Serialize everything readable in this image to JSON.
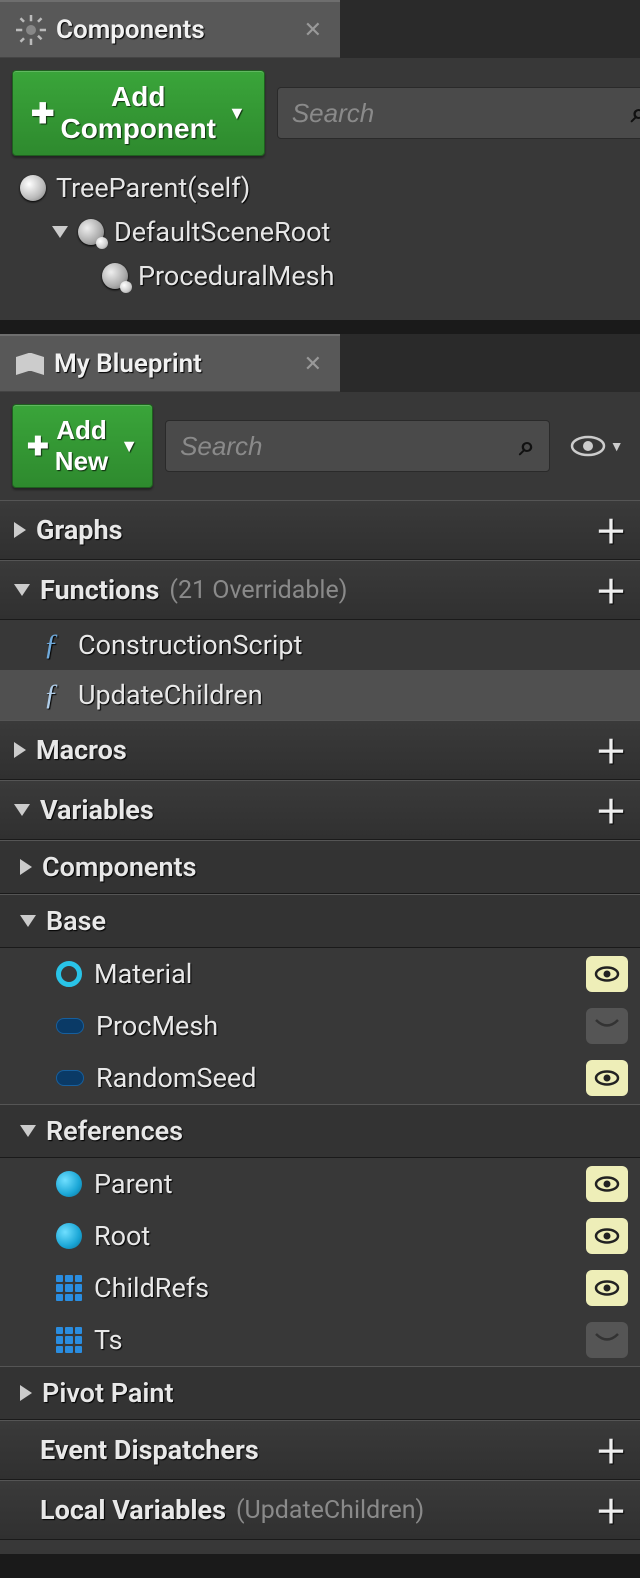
{
  "panels": {
    "components": {
      "tab_title": "Components",
      "add_button": "Add Component",
      "search_placeholder": "Search",
      "tree": {
        "root": "TreeParent(self)",
        "sceneRoot": "DefaultSceneRoot",
        "procMesh": "ProceduralMesh"
      }
    },
    "myblueprint": {
      "tab_title": "My Blueprint",
      "add_button": "Add New",
      "search_placeholder": "Search",
      "sections": {
        "graphs": "Graphs",
        "functions": "Functions",
        "functions_sub": "(21 Overridable)",
        "macros": "Macros",
        "variables": "Variables",
        "components_cat": "Components",
        "base_cat": "Base",
        "references_cat": "References",
        "pivot_cat": "Pivot Paint",
        "dispatchers": "Event Dispatchers",
        "localvars": "Local Variables",
        "localvars_sub": "(UpdateChildren)"
      },
      "functions": {
        "construction": "ConstructionScript",
        "update": "UpdateChildren"
      },
      "vars": {
        "material": "Material",
        "procmesh": "ProcMesh",
        "randomseed": "RandomSeed",
        "parent": "Parent",
        "root": "Root",
        "childrefs": "ChildRefs",
        "ts": "Ts"
      }
    }
  }
}
